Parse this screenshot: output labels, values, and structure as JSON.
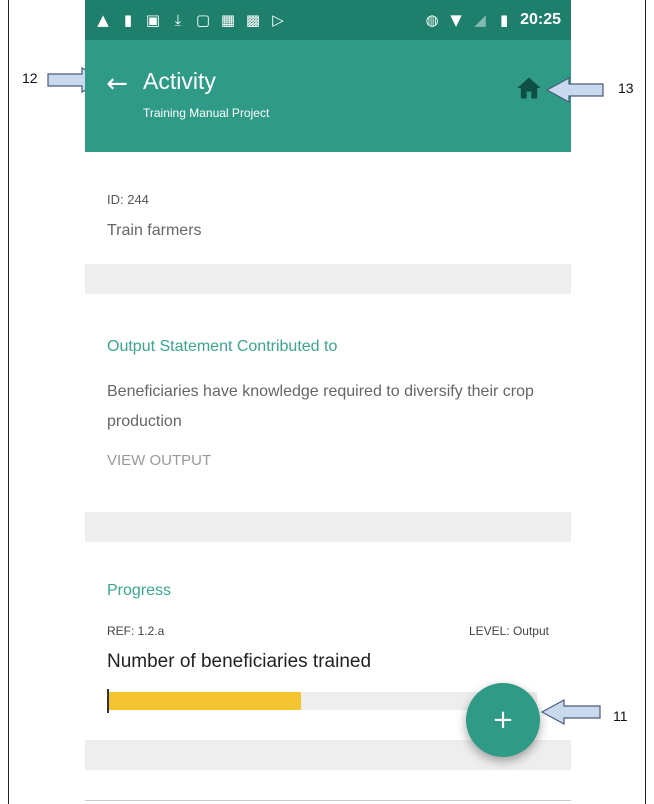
{
  "status_bar": {
    "left_icons": [
      "drive-icon",
      "person-icon",
      "image-icon",
      "download-icon",
      "tablet-icon",
      "calendar-icon",
      "photo-icon",
      "play-store-icon"
    ],
    "right_icons": [
      "vibrate-icon",
      "wifi-icon",
      "signal-icon",
      "battery-icon"
    ],
    "time": "20:25"
  },
  "app_bar": {
    "title": "Activity",
    "subtitle": "Training Manual Project",
    "color": "#2f9b86"
  },
  "activity": {
    "id_label": "ID: 244",
    "name": "Train farmers"
  },
  "output_section": {
    "heading": "Output Statement Contributed to",
    "statement": "Beneficiaries have knowledge required to diversify their crop production",
    "view_button": "VIEW OUTPUT"
  },
  "progress_section": {
    "heading": "Progress",
    "ref": "REF: 1.2.a",
    "level": "LEVEL: Output",
    "indicator": "Number of beneficiaries trained",
    "progress_fraction": 0.45,
    "bar_color": "#f4c430"
  },
  "fab": {
    "label": "+"
  },
  "callouts": {
    "back": "12",
    "home": "13",
    "fab": "11"
  }
}
